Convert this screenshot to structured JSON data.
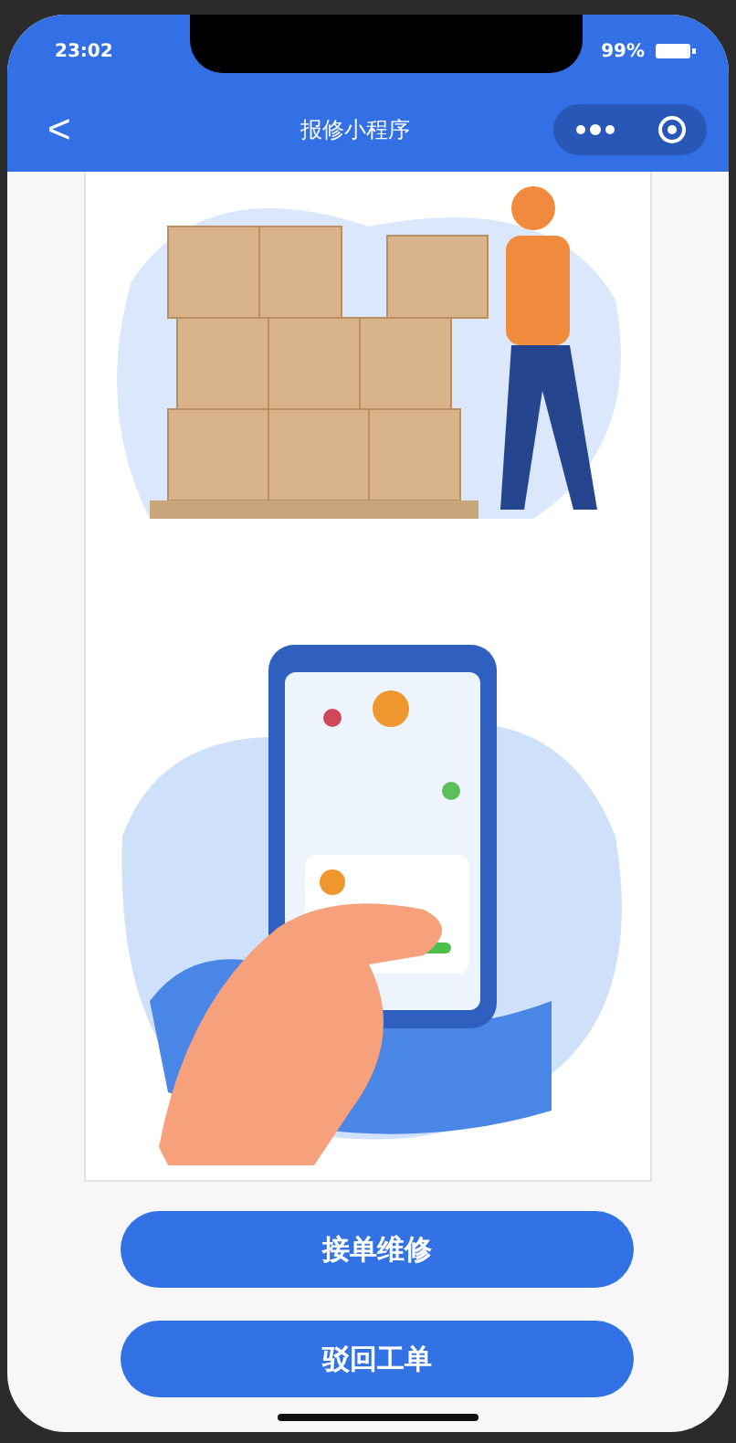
{
  "status_bar": {
    "time": "23:02",
    "battery": "99%"
  },
  "nav_bar": {
    "back": "<",
    "title": "报修小程序"
  },
  "buttons": [
    {
      "label": "接单维修"
    },
    {
      "label": "驳回工单"
    }
  ]
}
